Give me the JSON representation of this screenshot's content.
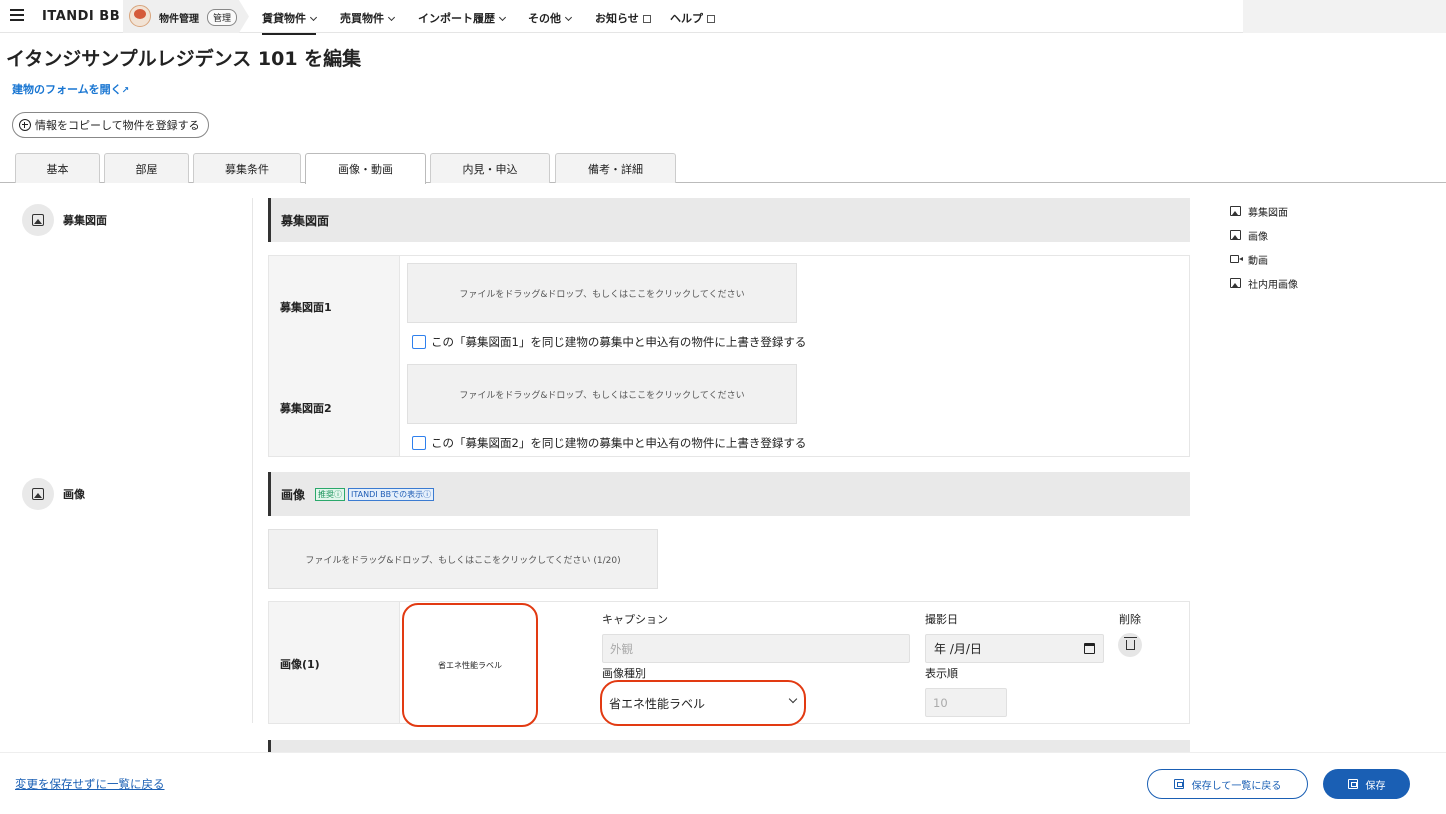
{
  "header": {
    "logo": "ITANDI BB",
    "brand_label": "物件管理",
    "brand_badge": "管理",
    "nav": [
      {
        "label": "賃貸物件"
      },
      {
        "label": "売買物件"
      },
      {
        "label": "インポート履歴"
      },
      {
        "label": "その他"
      },
      {
        "label": "お知らせ"
      },
      {
        "label": "ヘルプ"
      }
    ]
  },
  "page": {
    "title": "イタンジサンプルレジデンス 101 を編集",
    "open_form_link": "建物のフォームを開く",
    "copy_button": "情報をコピーして物件を登録する"
  },
  "tabs": [
    {
      "label": "基本"
    },
    {
      "label": "部屋"
    },
    {
      "label": "募集条件"
    },
    {
      "label": "画像・動画"
    },
    {
      "label": "内見・申込"
    },
    {
      "label": "備考・詳細"
    }
  ],
  "active_tab": "画像・動画",
  "floorplan_section": {
    "side_label": "募集図面",
    "heading": "募集図面",
    "rows": [
      {
        "label": "募集図面1",
        "dropzone": "ファイルをドラッグ&ドロップ、もしくはここをクリックしてください",
        "checkbox": "この「募集図面1」を同じ建物の募集中と申込有の物件に上書き登録する"
      },
      {
        "label": "募集図面2",
        "dropzone": "ファイルをドラッグ&ドロップ、もしくはここをクリックしてください",
        "checkbox": "この「募集図面2」を同じ建物の募集中と申込有の物件に上書き登録する"
      }
    ]
  },
  "image_section": {
    "side_label": "画像",
    "heading": "画像",
    "tag_recommended": "推奨ⓘ",
    "tag_display": "ITANDI BBでの表示ⓘ",
    "dropzone": "ファイルをドラッグ&ドロップ、もしくはここをクリックしてください (1/20)",
    "item": {
      "label": "画像(1)",
      "thumbnail_text": "省エネ性能ラベル",
      "caption_label": "キャプション",
      "caption_placeholder": "外観",
      "date_label": "撮影日",
      "date_placeholder": "年 /月/日",
      "delete_label": "削除",
      "type_label": "画像種別",
      "type_value": "省エネ性能ラベル",
      "order_label": "表示順",
      "order_placeholder": "10"
    }
  },
  "right_nav": [
    {
      "label": "募集図面",
      "icon": "image-icon"
    },
    {
      "label": "画像",
      "icon": "image-icon"
    },
    {
      "label": "動画",
      "icon": "video-icon"
    },
    {
      "label": "社内用画像",
      "icon": "image-icon"
    }
  ],
  "footer": {
    "back_link": "変更を保存せずに一覧に戻る",
    "save_back_button": "保存して一覧に戻る",
    "save_button": "保存"
  },
  "colors": {
    "accent": "#1a5fb4",
    "highlight": "#e23a12"
  }
}
